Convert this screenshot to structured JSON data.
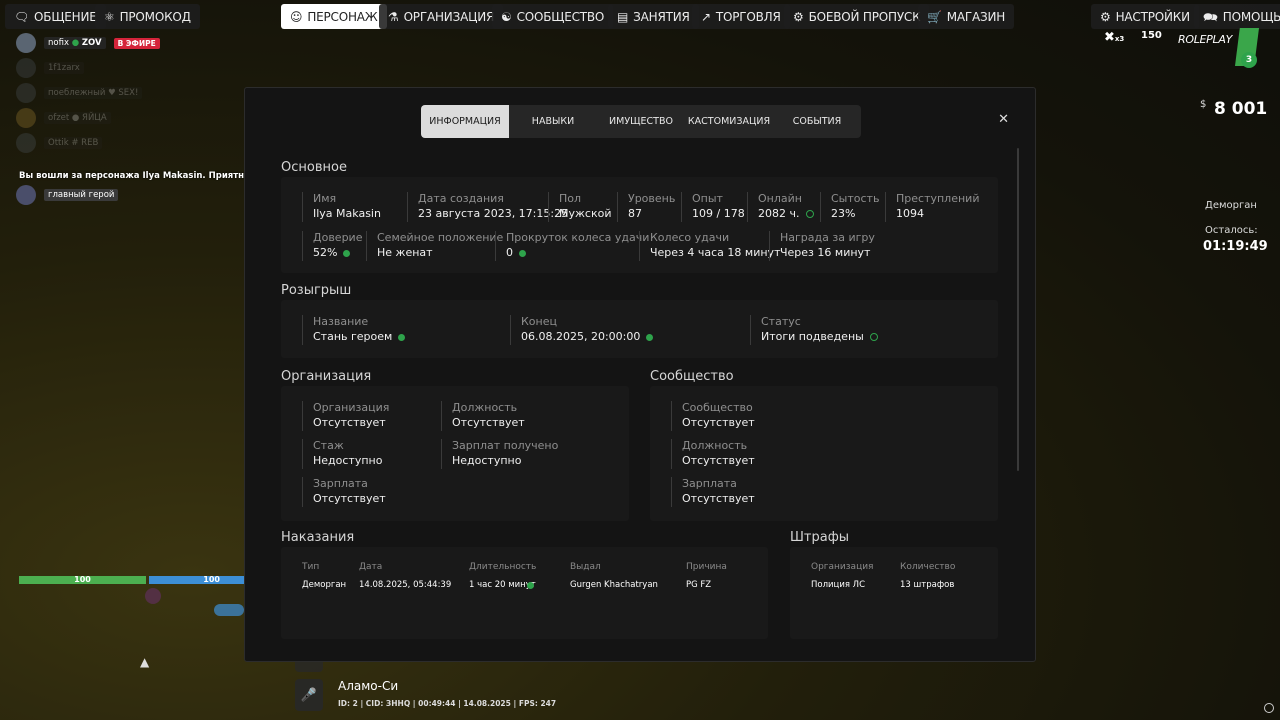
{
  "nav": {
    "left": [
      {
        "label": "ОБЩЕНИЕ",
        "icon": "chat-icon"
      },
      {
        "label": "ПРОМОКОД",
        "icon": "gift-icon"
      }
    ],
    "center": [
      {
        "label": "ПЕРСОНАЖ",
        "icon": "person-icon",
        "active": true
      },
      {
        "label": "ОРГАНИЗАЦИЯ",
        "icon": "org-icon"
      },
      {
        "label": "СООБЩЕСТВО",
        "icon": "community-icon"
      },
      {
        "label": "ЗАНЯТИЯ",
        "icon": "tasks-icon"
      },
      {
        "label": "ТОРГОВЛЯ",
        "icon": "chart-icon"
      },
      {
        "label": "БОЕВОЙ ПРОПУСК",
        "icon": "gear-icon"
      },
      {
        "label": "МАГАЗИН",
        "icon": "cart-icon"
      }
    ],
    "right": [
      {
        "label": "НАСТРОЙКИ",
        "icon": "settings-icon"
      },
      {
        "label": "ПОМОЩЬ",
        "icon": "help-icon"
      }
    ]
  },
  "chat": {
    "rows": [
      {
        "nick": "nofix",
        "tag": "ZOV",
        "badge": "В ЭФИРЕ"
      },
      {
        "nick": "1f1zarx"
      },
      {
        "nick": "поеблежный",
        "tag": "SEX!"
      },
      {
        "nick": "ofzet",
        "tag": "ЯЙЦА"
      },
      {
        "nick": "Ottik",
        "tag": "REB"
      }
    ],
    "message": "Вы вошли за персонажа Ilya Makasin. Приятной игры",
    "hero_label": "главный герой"
  },
  "hud": {
    "currency": "$",
    "money": "8 001",
    "jail_label": "Деморган",
    "remain_label": "Осталось:",
    "remain_time": "01:19:49",
    "logo_text": "ROLEPLAY",
    "badge_150": "150",
    "badge_x": "x3",
    "logo_num": "3",
    "health": "100",
    "armor": "100"
  },
  "tabs": [
    "ИНФОРМАЦИЯ",
    "НАВЫКИ",
    "ИМУЩЕСТВО",
    "КАСТОМИЗАЦИЯ",
    "СОБЫТИЯ"
  ],
  "basic": {
    "title": "Основное",
    "row1": [
      {
        "label": "Имя",
        "value": "Ilya Makasin"
      },
      {
        "label": "Дата создания",
        "value": "23 августа 2023, 17:15:25"
      },
      {
        "label": "Пол",
        "value": "Мужской"
      },
      {
        "label": "Уровень",
        "value": "87"
      },
      {
        "label": "Опыт",
        "value": "109 / 178"
      },
      {
        "label": "Онлайн",
        "value": "2082 ч."
      },
      {
        "label": "Сытость",
        "value": "23%"
      },
      {
        "label": "Преступлений",
        "value": "1094"
      }
    ],
    "row2": [
      {
        "label": "Доверие",
        "value": "52%"
      },
      {
        "label": "Семейное положение",
        "value": "Не женат"
      },
      {
        "label": "Прокруток колеса удачи",
        "value": "0"
      },
      {
        "label": "Колесо удачи",
        "value": "Через 4 часа 18 минут"
      },
      {
        "label": "Награда за игру",
        "value": "Через 16 минут"
      }
    ]
  },
  "raffle": {
    "title": "Розыгрыш",
    "fields": [
      {
        "label": "Название",
        "value": "Стань героем"
      },
      {
        "label": "Конец",
        "value": "06.08.2025, 20:00:00"
      },
      {
        "label": "Статус",
        "value": "Итоги подведены"
      }
    ]
  },
  "organization": {
    "title": "Организация",
    "fields": [
      {
        "label": "Организация",
        "value": "Отсутствует"
      },
      {
        "label": "Должность",
        "value": "Отсутствует"
      },
      {
        "label": "Стаж",
        "value": "Недоступно"
      },
      {
        "label": "Зарплат получено",
        "value": "Недоступно"
      },
      {
        "label": "Зарплата",
        "value": "Отсутствует"
      }
    ]
  },
  "community": {
    "title": "Сообщество",
    "fields": [
      {
        "label": "Сообщество",
        "value": "Отсутствует"
      },
      {
        "label": "Должность",
        "value": "Отсутствует"
      },
      {
        "label": "Зарплата",
        "value": "Отсутствует"
      }
    ]
  },
  "punishments": {
    "title": "Наказания",
    "headers": [
      "Тип",
      "Дата",
      "Длительность",
      "Выдал",
      "Причина"
    ],
    "row": [
      "Деморган",
      "14.08.2025, 05:44:39",
      "1 час 20 минут",
      "Gurgen Khachatryan",
      "PG FZ"
    ]
  },
  "fines": {
    "title": "Штрафы",
    "headers": [
      "Организация",
      "Количество"
    ],
    "row": [
      "Полиция ЛС",
      "13 штрафов"
    ]
  },
  "bottom": {
    "location": "Аламо-Си",
    "info": "ID: 2 | CID: ЗННQ | 00:49:44 | 14.08.2025 | FPS: 247"
  }
}
